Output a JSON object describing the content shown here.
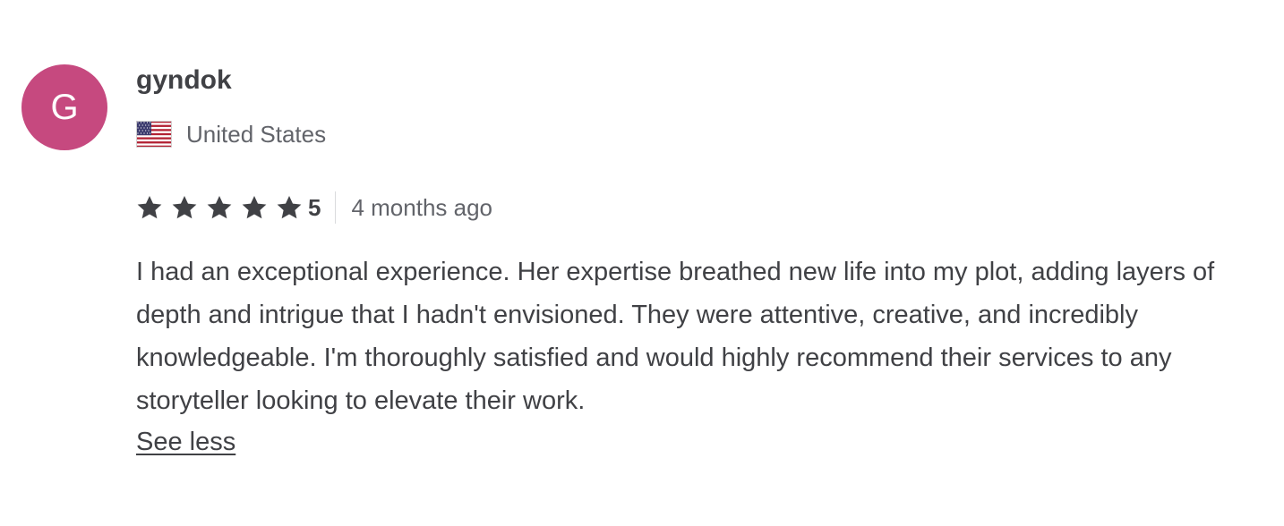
{
  "reviewer": {
    "avatar_letter": "G",
    "avatar_color": "#c6497f",
    "username": "gyndok",
    "country": "United States",
    "flag_icon": "us-flag-icon"
  },
  "rating": {
    "stars": 5,
    "value": "5",
    "star_color": "#404145",
    "time_ago": "4 months ago"
  },
  "review": {
    "text": "I had an exceptional experience. Her expertise breathed new life into my plot, adding layers of depth and intrigue that I hadn't envisioned. They were attentive, creative, and incredibly knowledgeable. I'm thoroughly satisfied and would highly recommend their services to any storyteller looking to elevate their work.",
    "toggle_label": "See less"
  }
}
